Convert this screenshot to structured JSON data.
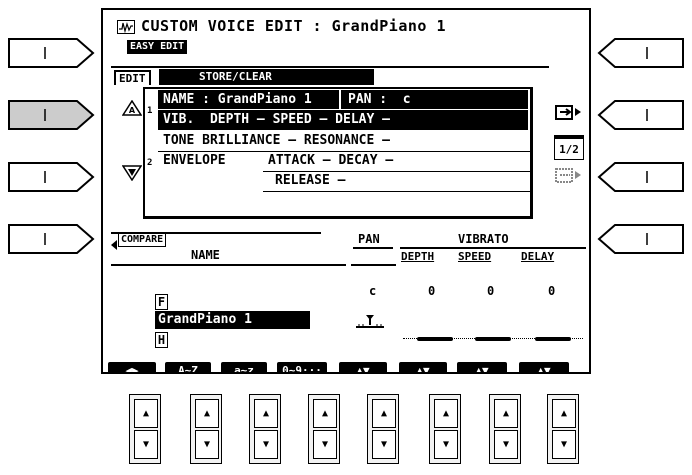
{
  "header": {
    "title": "CUSTOM VOICE EDIT : GrandPiano 1",
    "mode_badge": "EASY EDIT"
  },
  "tabs": {
    "edit": "EDIT",
    "store_clear": "STORE/CLEAR"
  },
  "menu": {
    "page1_num": "1",
    "page2_num": "2",
    "row1_name": "NAME : GrandPiano 1",
    "row1_pan": "PAN :  c",
    "row2": "VIB.  DEPTH — SPEED — DELAY —",
    "row3": "TONE BRILLIANCE — RESONANCE —",
    "row4_a": "ENVELOPE",
    "row4_b": "ATTACK — DECAY —",
    "row5": "RELEASE —",
    "page_indicator": "1/2"
  },
  "params": {
    "compare": "COMPARE",
    "name_header": "NAME",
    "pan_header": "PAN",
    "vibrato_header": "VIBRATO",
    "depth_header": "DEPTH",
    "speed_header": "SPEED",
    "delay_header": "DELAY",
    "pan_value": "c",
    "depth_value": "0",
    "speed_value": "0",
    "delay_value": "0",
    "name_value": "GrandPiano 1",
    "char_above": "F",
    "char_below": "H"
  },
  "softkeys": [
    "◀▶",
    "A~Z",
    "a~z",
    "0~9···",
    "▲▼",
    "▲▼",
    "▲▼",
    "▲▼"
  ],
  "physical_buttons": {
    "up_symbol": "▲",
    "down_symbol": "▼"
  }
}
